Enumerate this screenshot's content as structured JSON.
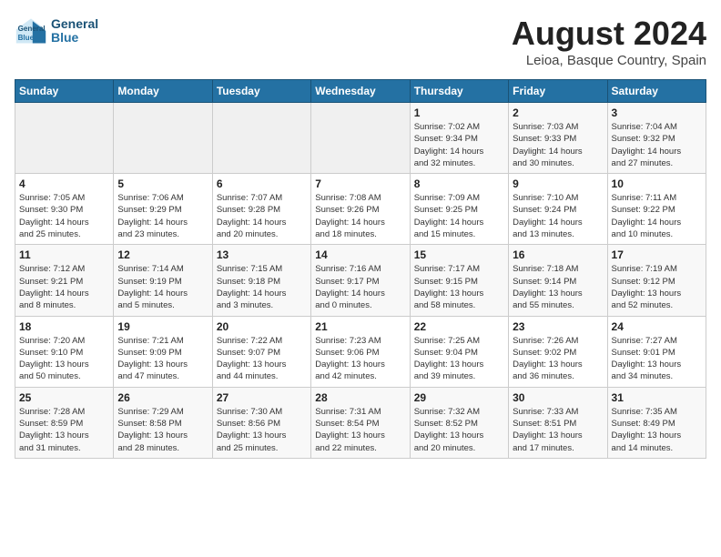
{
  "header": {
    "logo_line1": "General",
    "logo_line2": "Blue",
    "title": "August 2024",
    "subtitle": "Leioa, Basque Country, Spain"
  },
  "weekdays": [
    "Sunday",
    "Monday",
    "Tuesday",
    "Wednesday",
    "Thursday",
    "Friday",
    "Saturday"
  ],
  "weeks": [
    [
      {
        "day": "",
        "content": ""
      },
      {
        "day": "",
        "content": ""
      },
      {
        "day": "",
        "content": ""
      },
      {
        "day": "",
        "content": ""
      },
      {
        "day": "1",
        "content": "Sunrise: 7:02 AM\nSunset: 9:34 PM\nDaylight: 14 hours\nand 32 minutes."
      },
      {
        "day": "2",
        "content": "Sunrise: 7:03 AM\nSunset: 9:33 PM\nDaylight: 14 hours\nand 30 minutes."
      },
      {
        "day": "3",
        "content": "Sunrise: 7:04 AM\nSunset: 9:32 PM\nDaylight: 14 hours\nand 27 minutes."
      }
    ],
    [
      {
        "day": "4",
        "content": "Sunrise: 7:05 AM\nSunset: 9:30 PM\nDaylight: 14 hours\nand 25 minutes."
      },
      {
        "day": "5",
        "content": "Sunrise: 7:06 AM\nSunset: 9:29 PM\nDaylight: 14 hours\nand 23 minutes."
      },
      {
        "day": "6",
        "content": "Sunrise: 7:07 AM\nSunset: 9:28 PM\nDaylight: 14 hours\nand 20 minutes."
      },
      {
        "day": "7",
        "content": "Sunrise: 7:08 AM\nSunset: 9:26 PM\nDaylight: 14 hours\nand 18 minutes."
      },
      {
        "day": "8",
        "content": "Sunrise: 7:09 AM\nSunset: 9:25 PM\nDaylight: 14 hours\nand 15 minutes."
      },
      {
        "day": "9",
        "content": "Sunrise: 7:10 AM\nSunset: 9:24 PM\nDaylight: 14 hours\nand 13 minutes."
      },
      {
        "day": "10",
        "content": "Sunrise: 7:11 AM\nSunset: 9:22 PM\nDaylight: 14 hours\nand 10 minutes."
      }
    ],
    [
      {
        "day": "11",
        "content": "Sunrise: 7:12 AM\nSunset: 9:21 PM\nDaylight: 14 hours\nand 8 minutes."
      },
      {
        "day": "12",
        "content": "Sunrise: 7:14 AM\nSunset: 9:19 PM\nDaylight: 14 hours\nand 5 minutes."
      },
      {
        "day": "13",
        "content": "Sunrise: 7:15 AM\nSunset: 9:18 PM\nDaylight: 14 hours\nand 3 minutes."
      },
      {
        "day": "14",
        "content": "Sunrise: 7:16 AM\nSunset: 9:17 PM\nDaylight: 14 hours\nand 0 minutes."
      },
      {
        "day": "15",
        "content": "Sunrise: 7:17 AM\nSunset: 9:15 PM\nDaylight: 13 hours\nand 58 minutes."
      },
      {
        "day": "16",
        "content": "Sunrise: 7:18 AM\nSunset: 9:14 PM\nDaylight: 13 hours\nand 55 minutes."
      },
      {
        "day": "17",
        "content": "Sunrise: 7:19 AM\nSunset: 9:12 PM\nDaylight: 13 hours\nand 52 minutes."
      }
    ],
    [
      {
        "day": "18",
        "content": "Sunrise: 7:20 AM\nSunset: 9:10 PM\nDaylight: 13 hours\nand 50 minutes."
      },
      {
        "day": "19",
        "content": "Sunrise: 7:21 AM\nSunset: 9:09 PM\nDaylight: 13 hours\nand 47 minutes."
      },
      {
        "day": "20",
        "content": "Sunrise: 7:22 AM\nSunset: 9:07 PM\nDaylight: 13 hours\nand 44 minutes."
      },
      {
        "day": "21",
        "content": "Sunrise: 7:23 AM\nSunset: 9:06 PM\nDaylight: 13 hours\nand 42 minutes."
      },
      {
        "day": "22",
        "content": "Sunrise: 7:25 AM\nSunset: 9:04 PM\nDaylight: 13 hours\nand 39 minutes."
      },
      {
        "day": "23",
        "content": "Sunrise: 7:26 AM\nSunset: 9:02 PM\nDaylight: 13 hours\nand 36 minutes."
      },
      {
        "day": "24",
        "content": "Sunrise: 7:27 AM\nSunset: 9:01 PM\nDaylight: 13 hours\nand 34 minutes."
      }
    ],
    [
      {
        "day": "25",
        "content": "Sunrise: 7:28 AM\nSunset: 8:59 PM\nDaylight: 13 hours\nand 31 minutes."
      },
      {
        "day": "26",
        "content": "Sunrise: 7:29 AM\nSunset: 8:58 PM\nDaylight: 13 hours\nand 28 minutes."
      },
      {
        "day": "27",
        "content": "Sunrise: 7:30 AM\nSunset: 8:56 PM\nDaylight: 13 hours\nand 25 minutes."
      },
      {
        "day": "28",
        "content": "Sunrise: 7:31 AM\nSunset: 8:54 PM\nDaylight: 13 hours\nand 22 minutes."
      },
      {
        "day": "29",
        "content": "Sunrise: 7:32 AM\nSunset: 8:52 PM\nDaylight: 13 hours\nand 20 minutes."
      },
      {
        "day": "30",
        "content": "Sunrise: 7:33 AM\nSunset: 8:51 PM\nDaylight: 13 hours\nand 17 minutes."
      },
      {
        "day": "31",
        "content": "Sunrise: 7:35 AM\nSunset: 8:49 PM\nDaylight: 13 hours\nand 14 minutes."
      }
    ]
  ]
}
